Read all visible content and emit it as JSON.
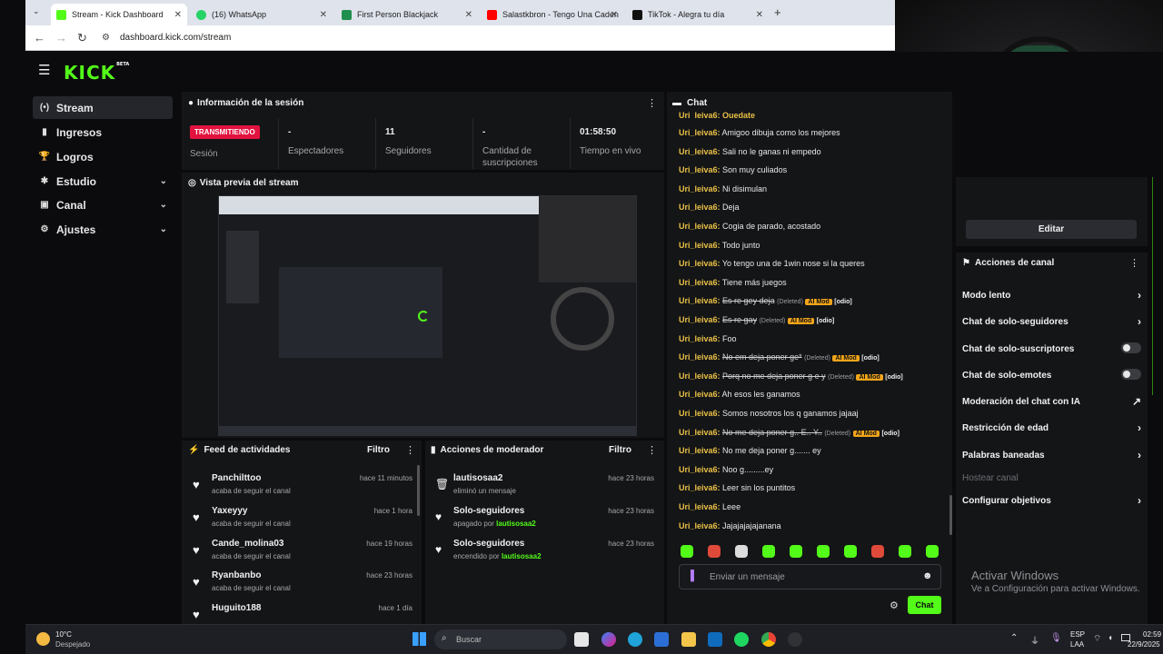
{
  "browser": {
    "tabs": [
      {
        "title": "Stream - Kick Dashboard",
        "color": "#53fc18"
      },
      {
        "title": "(16) WhatsApp",
        "color": "#25d366"
      },
      {
        "title": "First Person Blackjack",
        "color": "#1e8f4e"
      },
      {
        "title": "Salastkbron - Tengo Una Caden",
        "color": "#ff0000"
      },
      {
        "title": "TikTok - Alegra tu día",
        "color": "#111111"
      }
    ],
    "url": "dashboard.kick.com/stream"
  },
  "kick": {
    "logo": "KICK",
    "logo_badge": "BETA",
    "accent": "#53fc18",
    "nav": [
      {
        "label": "Stream",
        "icon": "(•)"
      },
      {
        "label": "Ingresos",
        "icon": "▮"
      },
      {
        "label": "Logros",
        "icon": "🏆"
      },
      {
        "label": "Estudio",
        "icon": "✱"
      },
      {
        "label": "Canal",
        "icon": "▣"
      },
      {
        "label": "Ajustes",
        "icon": "⚙"
      }
    ],
    "session": {
      "title": "Información de la sesión",
      "status": "TRANSMITIENDO",
      "status_label": "Sesión",
      "stats": [
        {
          "value": "-",
          "label": "Espectadores"
        },
        {
          "value": "11",
          "label": "Seguidores"
        },
        {
          "value": "-",
          "label": "Cantidad de suscripciones"
        },
        {
          "value": "01:58:50",
          "label": "Tiempo en vivo"
        }
      ]
    },
    "preview_title": "Vista previa del stream",
    "feed": {
      "title": "Feed de actividades",
      "filter": "Filtro",
      "items": [
        {
          "name": "Panchilttoo",
          "desc": "acaba de seguir el canal",
          "time": "hace 11 minutos"
        },
        {
          "name": "Yaxeyyy",
          "desc": "acaba de seguir el canal",
          "time": "hace 1 hora"
        },
        {
          "name": "Cande_molina03",
          "desc": "acaba de seguir el canal",
          "time": "hace 19 horas"
        },
        {
          "name": "Ryanbanbo",
          "desc": "acaba de seguir el canal",
          "time": "hace 23 horas"
        },
        {
          "name": "Huguito188",
          "desc": "",
          "time": "hace 1 día"
        }
      ]
    },
    "mod": {
      "title": "Acciones de moderador",
      "filter": "Filtro",
      "items": [
        {
          "name": "lautisosaa2",
          "desc": "eliminó un mensaje",
          "by": "",
          "time": "hace 23 horas",
          "icon": "trash-icon"
        },
        {
          "name": "Solo-seguidores",
          "desc": "apagado por",
          "by": "lautisosaa2",
          "time": "hace 23 horas",
          "icon": "heart-icon"
        },
        {
          "name": "Solo-seguidores",
          "desc": "encendido por",
          "by": "lautisosaa2",
          "time": "hace 23 horas",
          "icon": "heart-icon"
        }
      ]
    },
    "chat": {
      "title": "Chat",
      "top_partial": "Uri_leiva6: Quedate",
      "messages": [
        {
          "user": "Uri_leiva6:",
          "text": "Amigoo dibuja como los mejores"
        },
        {
          "user": "Uri_leiva6:",
          "text": "Sali no le ganas ni empedo"
        },
        {
          "user": "Uri_leiva6:",
          "text": "Son muy culiados"
        },
        {
          "user": "Uri_leiva6:",
          "text": "Ni disimulan"
        },
        {
          "user": "Uri_leiva6:",
          "text": "Deja"
        },
        {
          "user": "Uri_leiva6:",
          "text": "Cogia de parado, acostado"
        },
        {
          "user": "Uri_leiva6:",
          "text": "Todo junto"
        },
        {
          "user": "Uri_leiva6:",
          "text": "Yo tengo una de 1win nose si la queres"
        },
        {
          "user": "Uri_leiva6:",
          "text": "Tiene más juegos"
        },
        {
          "user": "Uri_leiva6:",
          "text": "Es re gey deja",
          "deleted": "(Deleted)",
          "badge": "AI Mod",
          "tag": "[odio]"
        },
        {
          "user": "Uri_leiva6:",
          "text": "Es re gay",
          "deleted": "(Deleted)",
          "badge": "AI Mod",
          "tag": "[odio]"
        },
        {
          "user": "Uri_leiva6:",
          "text": "Foo"
        },
        {
          "user": "Uri_leiva6:",
          "text": "No em deja poner ge*",
          "deleted": "(Deleted)",
          "badge": "AI Mod",
          "tag": "[odio]"
        },
        {
          "user": "Uri_leiva6:",
          "text": "Porq no me deja poner g e y",
          "deleted": "(Deleted)",
          "badge": "AI Mod",
          "tag": "[odio]"
        },
        {
          "user": "Uri_leiva6:",
          "text": "Ah esos les ganamos"
        },
        {
          "user": "Uri_leiva6:",
          "text": "Somos nosotros los q ganamos jajaaj"
        },
        {
          "user": "Uri_leiva6:",
          "text": "No me deja poner g.. E.. Y..",
          "deleted": "(Deleted)",
          "badge": "AI Mod",
          "tag": "[odio]"
        },
        {
          "user": "Uri_leiva6:",
          "text": "No me deja poner g....... ey"
        },
        {
          "user": "Uri_leiva6:",
          "text": "Noo g.........ey"
        },
        {
          "user": "Uri_leiva6:",
          "text": "Leer sin los puntitos"
        },
        {
          "user": "Uri_leiva6:",
          "text": "Leee"
        },
        {
          "user": "Uri_leiva6:",
          "text": "Jajajajajajanana"
        }
      ],
      "placeholder": "Enviar un mensaje",
      "send": "Chat"
    },
    "right": {
      "edit": "Editar",
      "actions_title": "Acciones de canal",
      "rows": [
        {
          "label": "Modo lento",
          "control": "chevron"
        },
        {
          "label": "Chat de solo-seguidores",
          "control": "chevron"
        },
        {
          "label": "Chat de solo-suscriptores",
          "control": "toggle"
        },
        {
          "label": "Chat de solo-emotes",
          "control": "toggle"
        },
        {
          "label": "Moderación del chat con IA",
          "control": "link"
        },
        {
          "label": "Restricción de edad",
          "control": "chevron"
        },
        {
          "label": "Palabras baneadas",
          "control": "chevron"
        },
        {
          "label": "Hostear canal",
          "control": "disabled"
        },
        {
          "label": "Configurar objetivos",
          "control": "chevron"
        }
      ]
    },
    "watermark": {
      "title": "Activar Windows",
      "sub": "Ve a Configuración para activar Windows."
    }
  },
  "taskbar": {
    "weather_temp": "10°C",
    "weather_desc": "Despejado",
    "search": "Buscar",
    "lang": "ESP",
    "lang2": "LAA",
    "time": "02:59",
    "date": "22/9/2025"
  }
}
